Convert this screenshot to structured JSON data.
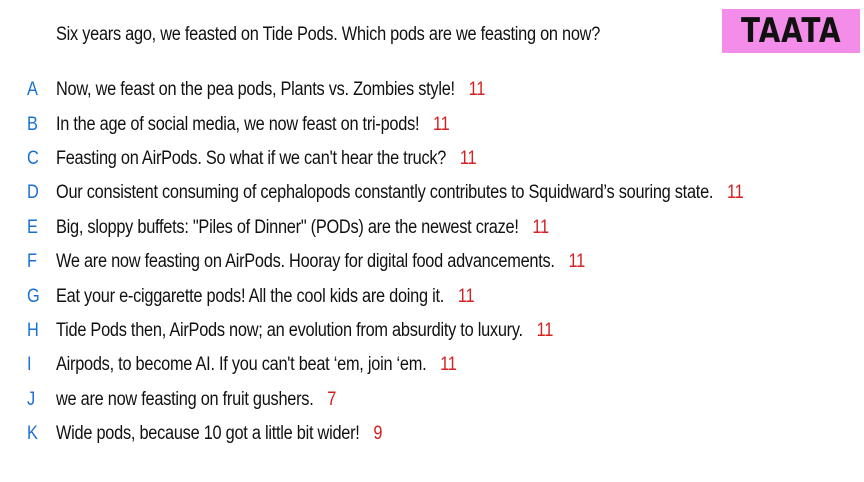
{
  "question": "Six years ago, we feasted on Tide Pods. Which pods are we feasting on now?",
  "logo": "TAATA",
  "colors": {
    "letter": "#1a6fd4",
    "score": "#d42020",
    "logo_bg": "#f48ce9"
  },
  "answers": [
    {
      "letter": "A",
      "text": "Now, we feast on the pea pods, Plants vs. Zombies style!",
      "score": "11"
    },
    {
      "letter": "B",
      "text": "In the age of social media, we now feast on tri-pods!",
      "score": "11"
    },
    {
      "letter": "C",
      "text": "Feasting on AirPods. So what if we can't hear the truck?",
      "score": "11"
    },
    {
      "letter": "D",
      "text": "Our consistent consuming of cephalopods constantly contributes to Squidward’s souring state.",
      "score": "11"
    },
    {
      "letter": "E",
      "text": "Big, sloppy buffets: \"Piles of Dinner\" (PODs) are the newest craze!",
      "score": "11"
    },
    {
      "letter": "F",
      "text": "We are now feasting on AirPods. Hooray for digital food advancements.",
      "score": "11"
    },
    {
      "letter": "G",
      "text": "Eat your e-ciggarette pods! All the cool kids are doing it.",
      "score": "11"
    },
    {
      "letter": "H",
      "text": "Tide Pods then, AirPods now; an evolution from absurdity to luxury.",
      "score": "11"
    },
    {
      "letter": "I",
      "text": "Airpods, to become AI. If you can't beat ‘em, join ‘em.",
      "score": "11"
    },
    {
      "letter": "J",
      "text": "we are now feasting on fruit gushers.",
      "score": "7"
    },
    {
      "letter": "K",
      "text": "Wide pods, because 10 got a little bit wider!",
      "score": "9"
    }
  ]
}
